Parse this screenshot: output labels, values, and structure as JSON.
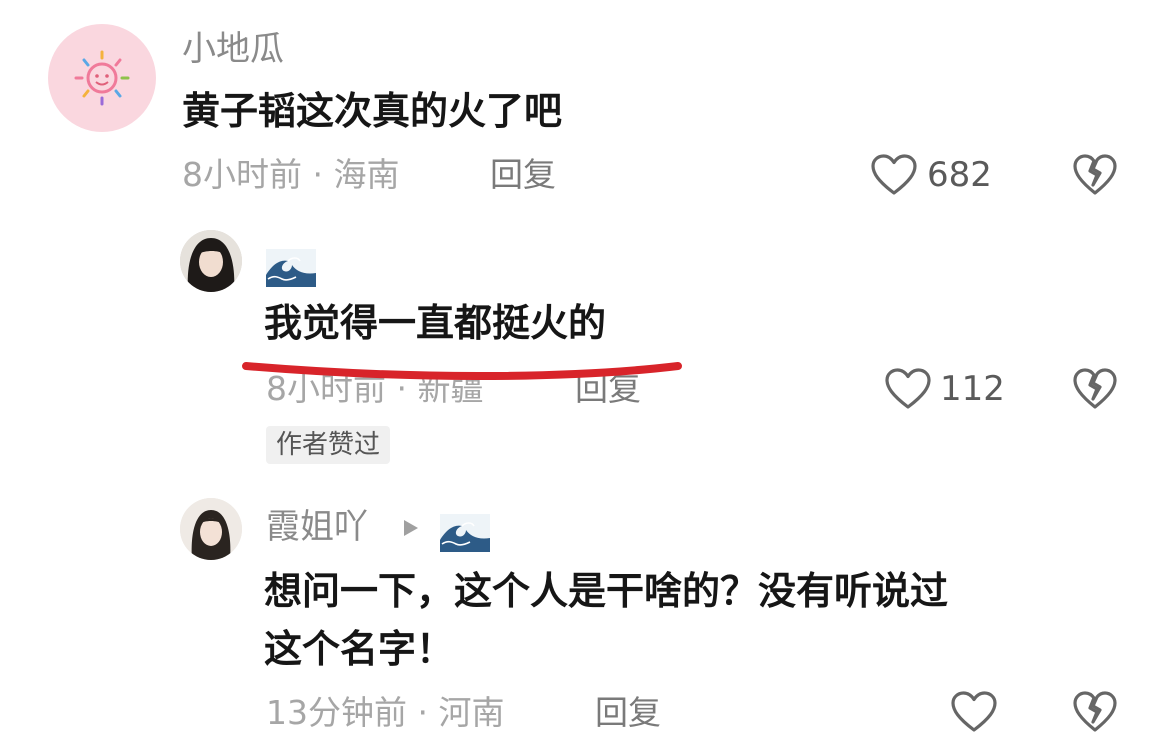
{
  "comments": [
    {
      "username": "小地瓜",
      "text": "黄子韬这次真的火了吧",
      "meta": "8小时前 · 海南",
      "reply_label": "回复",
      "likes": "682",
      "avatar_icon": "sun-doodle-avatar"
    },
    {
      "username": "",
      "username_icon": "wave-icon",
      "text": "我觉得一直都挺火的",
      "meta": "8小时前 · 新疆",
      "reply_label": "回复",
      "likes": "112",
      "badge": "作者赞过",
      "highlight_color": "#d8242a"
    },
    {
      "username": "霞姐吖",
      "username_icon": "wave-icon",
      "text_line1": "想问一下，这个人是干啥的？没有听说过",
      "text_line2": "这个名字！",
      "meta": "13分钟前 · 河南",
      "reply_label": "回复",
      "likes": ""
    }
  ]
}
